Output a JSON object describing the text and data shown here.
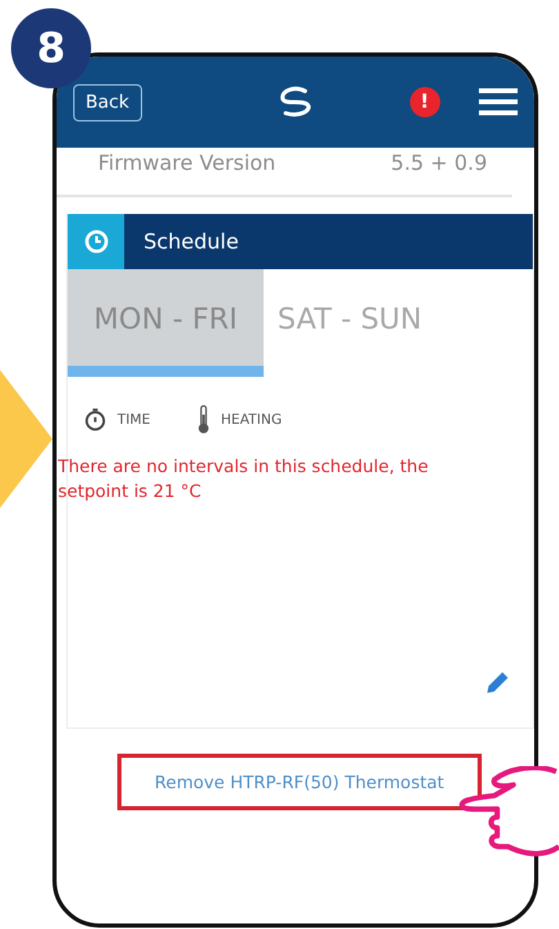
{
  "step": "8",
  "header": {
    "back": "Back",
    "alert": "!"
  },
  "firmware": {
    "label": "Firmware Version",
    "value": "5.5 + 0.9"
  },
  "schedule": {
    "title": "Schedule",
    "tabs": [
      {
        "label": "MON - FRI",
        "selected": true
      },
      {
        "label": "SAT - SUN",
        "selected": false
      }
    ],
    "columns": [
      {
        "kind": "time",
        "label": "TIME"
      },
      {
        "kind": "heating",
        "label": "HEATING"
      }
    ],
    "message": "There are no intervals in this schedule, the setpoint is 21 °C"
  },
  "remove_link": {
    "label": "Remove HTRP-RF(50) Thermostat",
    "highlighted": true
  }
}
